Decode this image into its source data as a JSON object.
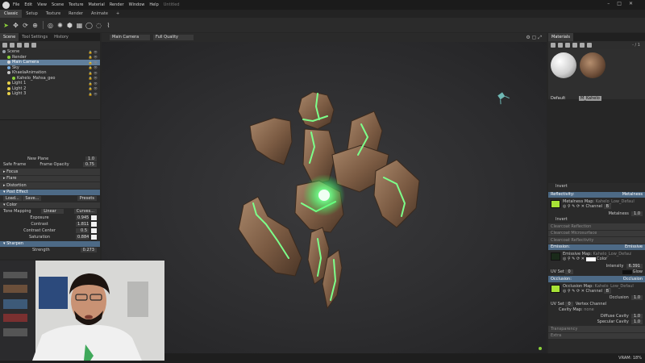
{
  "titlebar": {
    "menus": [
      "File",
      "Edit",
      "View",
      "Scene",
      "Texture",
      "Material",
      "Render",
      "Window",
      "Help"
    ],
    "title": "Untitled"
  },
  "workspace_tabs": [
    "Classic",
    "Setup",
    "Texture",
    "Render",
    "Animate",
    "+"
  ],
  "left_panel": {
    "tabs": [
      "Scene",
      "Tool Settings",
      "History"
    ],
    "tree": [
      {
        "label": "Scene",
        "indent": 0,
        "color": "#9aa4ad"
      },
      {
        "label": "Render",
        "indent": 1,
        "color": "#8bd13b"
      },
      {
        "label": "Main Camera",
        "indent": 1,
        "color": "#d8d8d8",
        "selected": true
      },
      {
        "label": "Sky",
        "indent": 1,
        "color": "#79aee0"
      },
      {
        "label": "KhaelaAnimation",
        "indent": 1,
        "color": "#c7c7c7"
      },
      {
        "label": "Kahelo_Mahsa_geo",
        "indent": 2,
        "color": "#8bd13b"
      },
      {
        "label": "Light 1",
        "indent": 1,
        "color": "#e8d24a"
      },
      {
        "label": "Light 2",
        "indent": 1,
        "color": "#e8d24a"
      },
      {
        "label": "Light 3",
        "indent": 1,
        "color": "#e8d24a"
      }
    ],
    "new_plane": "New Plane",
    "new_plane_value": "1.0",
    "safe_frame": "Safe Frame",
    "frame_opacity": "Frame Opacity",
    "frame_opacity_value": "0.75",
    "focus": "Focus",
    "flare": "Flare",
    "distortion": "Distortion",
    "post_effect": "Post Effect",
    "load": "Load...",
    "save": "Save...",
    "presets": "Presets",
    "color": "Color",
    "tone_mapping": "Tone Mapping",
    "tone_mapping_value": "Linear",
    "curves": "Curves...",
    "exposure": "Exposure",
    "exposure_value": "0.945",
    "contrast": "Contrast",
    "contrast_value": "1.811",
    "contrast_center": "Contrast Center",
    "contrast_center_value": "0.5",
    "saturation": "Saturation",
    "saturation_value": "0.884",
    "sharpen": "Sharpen",
    "strength": "Strength",
    "strength_value": "0.273"
  },
  "viewport": {
    "camera": "Main Camera",
    "quality": "Full Quality"
  },
  "right_panel": {
    "tab": "Materials",
    "page": "- / 1",
    "materials": [
      {
        "name": "Default"
      },
      {
        "name": "M_Kahelo"
      }
    ],
    "invert": "Invert",
    "reflectivity": "Reflectivity:",
    "reflectivity_mode": "Metalness",
    "metalness_map": "Metalness Map:",
    "metalness_map_file": "Kahelo_Low_DefaultMa",
    "channel": "Channel",
    "channel_value": "B",
    "metalness": "Metalness",
    "metalness_value": "1.0",
    "invert2": "Invert",
    "clearcoat_reflection": "Clearcoat Reflection",
    "clearcoat_microsurface": "Clearcoat Microsurface",
    "clearcoat_reflectivity": "Clearcoat Reflectivity",
    "emission": "Emission:",
    "emission_mode": "Emissive",
    "emissive_map": "Emissive Map:",
    "emissive_map_file": "Kahelo_Low_DefaultMa",
    "color": "Color",
    "intensity": "Intensity",
    "intensity_value": "6.391",
    "uv_set": "UV Set",
    "uv_set_value": "0",
    "glow": "Glow",
    "occlusion": "Occlusion:",
    "occlusion_mode": "Occlusion",
    "occlusion_map": "Occlusion Map:",
    "occlusion_map_file": "Kahelo_Low_DefaultMa",
    "occlusion_value": "1.0",
    "vertex_channel": "Vertex Channel",
    "cavity_map": "Cavity Map:",
    "cavity_map_file": "none",
    "diffuse_cavity": "Diffuse Cavity",
    "diffuse_cavity_value": "1.0",
    "specular_cavity": "Specular Cavity",
    "specular_cavity_value": "1.0",
    "transparency": "Transparency",
    "extra": "Extra"
  },
  "statusbar": {
    "vram": "VRAM: 18%"
  },
  "colors": {
    "accent": "#4d6a86",
    "glow": "#7dff8a",
    "rock": "#8a6a50"
  }
}
